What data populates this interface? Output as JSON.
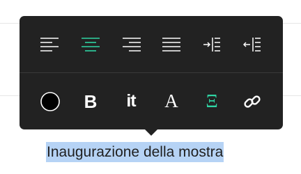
{
  "colors": {
    "toolbar_bg": "#222222",
    "icon_default": "#ffffff",
    "icon_active": "#2fd4a3",
    "selection_bg": "#b6d3f5",
    "text": "#1f1f1f"
  },
  "toolbar": {
    "row1": [
      {
        "id": "align-left",
        "icon": "align-left-icon",
        "active": false
      },
      {
        "id": "align-center",
        "icon": "align-center-icon",
        "active": true
      },
      {
        "id": "align-right",
        "icon": "align-right-icon",
        "active": false
      },
      {
        "id": "align-justify",
        "icon": "align-justify-icon",
        "active": false
      },
      {
        "id": "indent",
        "icon": "indent-icon",
        "active": false
      },
      {
        "id": "outdent",
        "icon": "outdent-icon",
        "active": false
      }
    ],
    "row2": [
      {
        "id": "text-color",
        "icon": "color-circle-icon",
        "active": false
      },
      {
        "id": "bold",
        "label": "B",
        "active": false
      },
      {
        "id": "italic",
        "label": "it",
        "active": false
      },
      {
        "id": "font",
        "label": "A",
        "active": false
      },
      {
        "id": "heading",
        "label": "Ξ",
        "active": true
      },
      {
        "id": "link",
        "icon": "link-icon",
        "active": false
      }
    ]
  },
  "content": {
    "selected_text": "Inaugurazione della mostra"
  }
}
